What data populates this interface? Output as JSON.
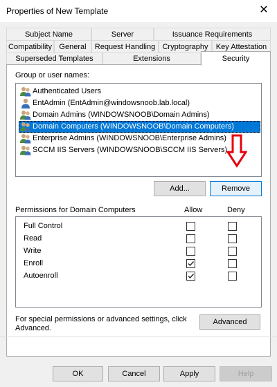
{
  "window": {
    "title": "Properties of New Template",
    "close_icon": "close-icon"
  },
  "tabs": {
    "row1": [
      "Subject Name",
      "Server",
      "Issuance Requirements"
    ],
    "row2": [
      "Compatibility",
      "General",
      "Request Handling",
      "Cryptography",
      "Key Attestation"
    ],
    "row3": [
      "Superseded Templates",
      "Extensions",
      "Security"
    ],
    "active": "Security"
  },
  "security": {
    "group_label": "Group or user names:",
    "users": [
      {
        "name": "Authenticated Users",
        "icon": "users-group-icon",
        "selected": false
      },
      {
        "name": "EntAdmin (EntAdmin@windowsnoob.lab.local)",
        "icon": "user-icon",
        "selected": false
      },
      {
        "name": "Domain Admins (WINDOWSNOOB\\Domain Admins)",
        "icon": "users-group-icon",
        "selected": false
      },
      {
        "name": "Domain Computers (WINDOWSNOOB\\Domain Computers)",
        "icon": "users-group-icon",
        "selected": true
      },
      {
        "name": "Enterprise Admins (WINDOWSNOOB\\Enterprise Admins)",
        "icon": "users-group-icon",
        "selected": false
      },
      {
        "name": "SCCM IIS Servers (WINDOWSNOOB\\SCCM IIS Servers)",
        "icon": "users-group-icon",
        "selected": false
      }
    ],
    "add_button": "Add...",
    "remove_button": "Remove",
    "permissions_label": "Permissions for Domain Computers",
    "allow_header": "Allow",
    "deny_header": "Deny",
    "permissions": [
      {
        "name": "Full Control",
        "allow": false,
        "deny": false
      },
      {
        "name": "Read",
        "allow": false,
        "deny": false
      },
      {
        "name": "Write",
        "allow": false,
        "deny": false
      },
      {
        "name": "Enroll",
        "allow": true,
        "deny": false
      },
      {
        "name": "Autoenroll",
        "allow": true,
        "deny": false
      }
    ],
    "advanced_note_line1": "For special permissions or advanced settings, click",
    "advanced_note_line2": "Advanced.",
    "advanced_button": "Advanced",
    "annotation_color": "#e8000b"
  },
  "footer": {
    "ok": "OK",
    "cancel": "Cancel",
    "apply": "Apply",
    "help": "Help"
  }
}
